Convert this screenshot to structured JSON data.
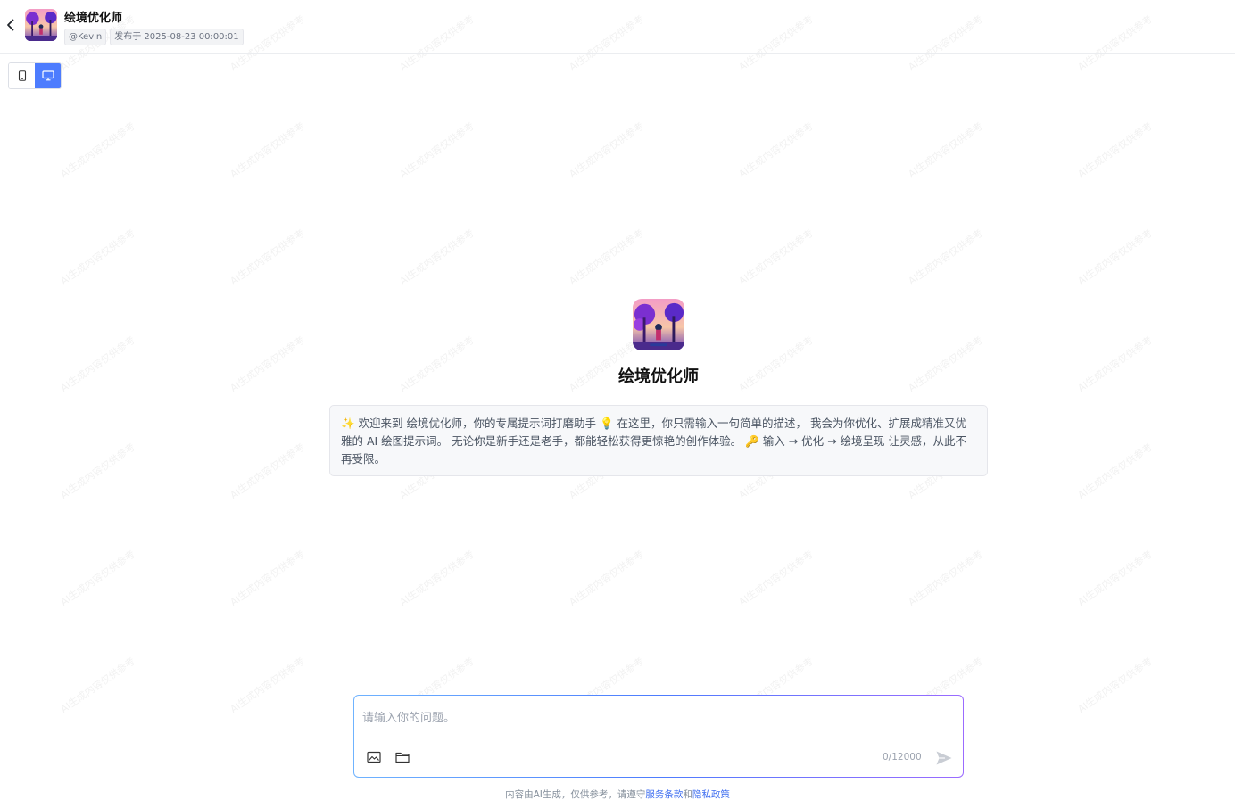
{
  "header": {
    "title": "绘境优化师",
    "author": "@Kevin",
    "published": "发布于 2025-08-23 00:00:01"
  },
  "device_toggle": {
    "options": [
      "mobile",
      "desktop"
    ],
    "selected": "desktop"
  },
  "intro": {
    "name": "绘境优化师",
    "welcome_parts": [
      "✨",
      " 欢迎来到 绘境优化师，你的专属提示词打磨助手 ",
      "💡",
      " 在这里，你只需输入一句简单的描述， 我会为你优化、扩展成精准又优雅的 AI 绘图提示词。 无论你是新手还是老手，都能轻松获得更惊艳的创作体验。 ",
      "🔑",
      " 输入 → 优化 → 绘境呈现 让灵感，从此不再受限。"
    ]
  },
  "chat": {
    "placeholder": "请输入你的问题。",
    "value": "",
    "counter": "0/12000"
  },
  "footer": {
    "prefix": "内容由AI生成，仅供参考，请遵守",
    "terms_link": "服务条款",
    "and": "和",
    "privacy_link": "隐私政策"
  },
  "watermark_text": "AI生成内容仅供参考",
  "colors": {
    "accent": "#4d7cfe",
    "link": "#3c6cf0",
    "border_gradient_start": "#6fb3ff",
    "border_gradient_end": "#9b6bff"
  },
  "icons": {
    "back": "chevron-left-icon",
    "mobile": "mobile-icon",
    "desktop": "desktop-icon",
    "image": "image-icon",
    "folder": "folder-icon",
    "send": "send-icon"
  }
}
